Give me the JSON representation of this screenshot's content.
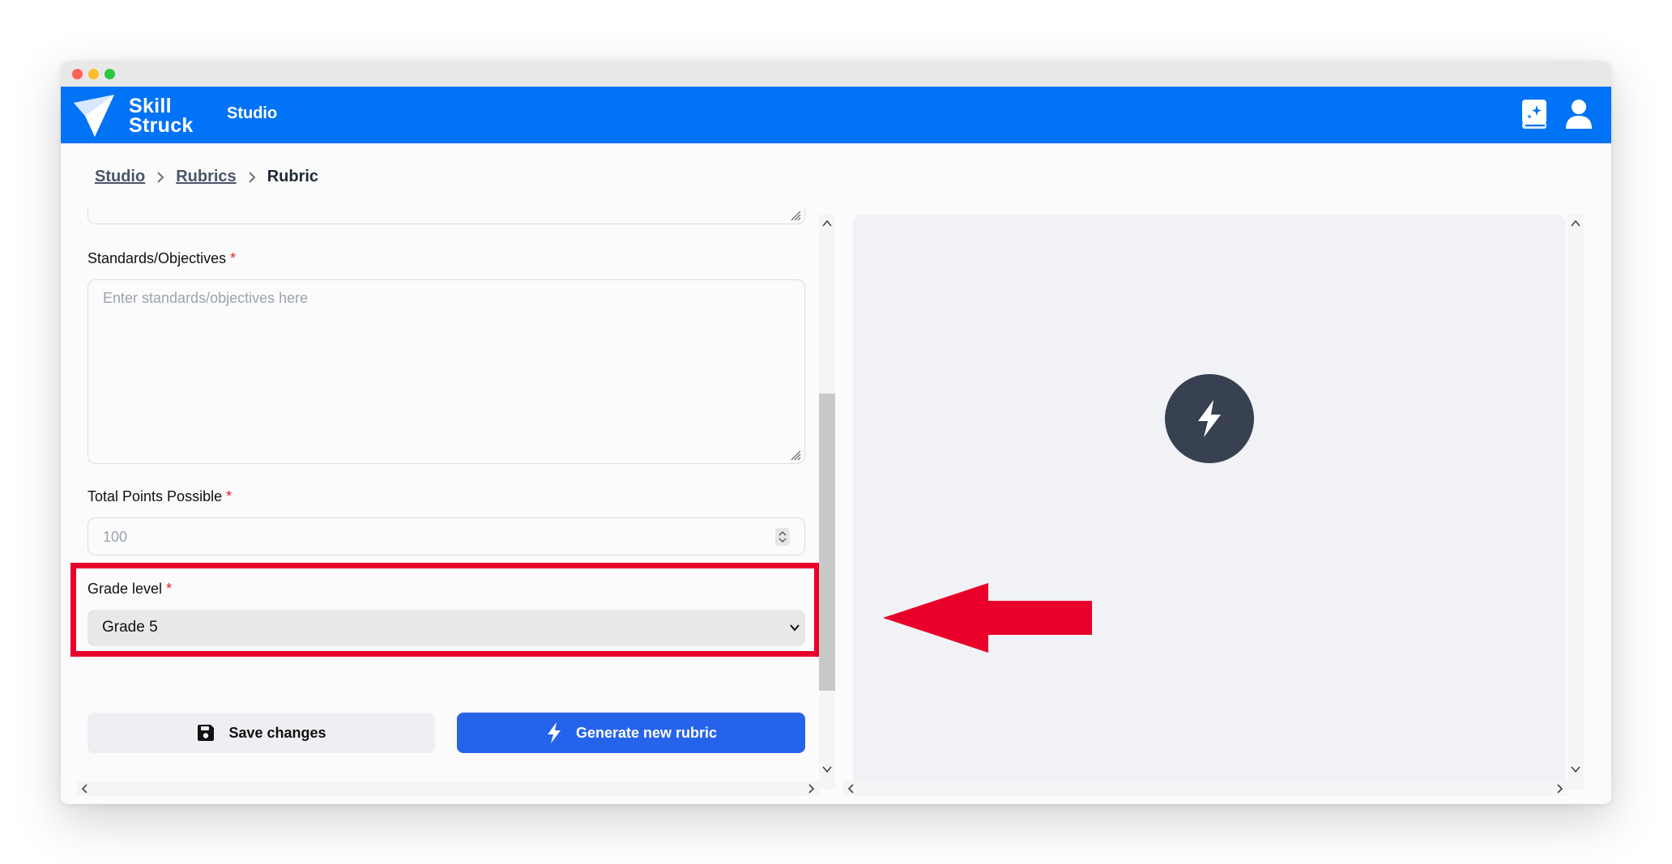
{
  "app": {
    "brand_line1": "Skill",
    "brand_line2": "Struck",
    "section": "Studio"
  },
  "breadcrumb": {
    "items": [
      "Studio",
      "Rubrics"
    ],
    "current": "Rubric"
  },
  "form": {
    "standards_label": "Standards/Objectives",
    "standards_placeholder": "Enter standards/objectives here",
    "points_label": "Total Points Possible",
    "points_placeholder": "100",
    "grade_label": "Grade level",
    "grade_value": "Grade 5",
    "required_marker": "*"
  },
  "actions": {
    "save_label": "Save changes",
    "generate_label": "Generate new rubric"
  },
  "colors": {
    "brand_blue": "#0073f7",
    "primary_button": "#2563eb",
    "highlight_red": "#e8002b"
  }
}
